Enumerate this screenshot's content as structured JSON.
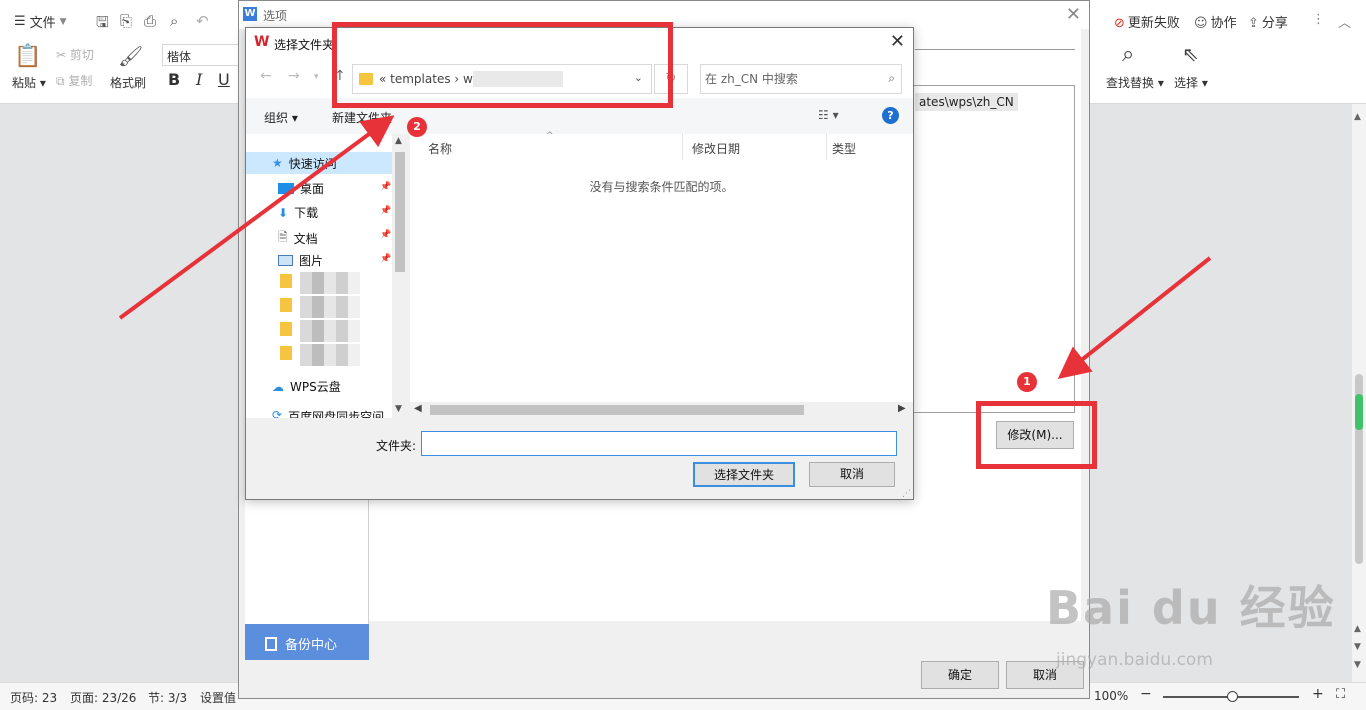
{
  "ribbon": {
    "file_menu": "文件",
    "paste": "粘贴",
    "cut": "剪切",
    "copy": "复制",
    "format_painter": "格式刷",
    "font_name": "楷体",
    "bold": "B",
    "italic": "I",
    "underline": "U",
    "update_failed": "更新失败",
    "collaborate": "协作",
    "share": "分享",
    "find_replace": "查找替换",
    "select": "选择"
  },
  "status_bar": {
    "page_code": "页码: 23",
    "pages": "页面: 23/26",
    "section": "节: 3/3",
    "setting_value": "设置值",
    "zoom": "100%"
  },
  "options_dialog": {
    "title": "选项",
    "path_fragment": "ates\\wps\\zh_CN",
    "modify_button": "修改(M)...",
    "backup_center": "备份中心",
    "ok_button": "确定",
    "cancel_button": "取消"
  },
  "picker": {
    "title": "选择文件夹",
    "breadcrumb": "« templates › wp",
    "search_placeholder": "在 zh_CN 中搜索",
    "organize": "组织 ▾",
    "new_folder": "新建文件夹",
    "nav_items": {
      "quick_access": "快速访问",
      "desktop": "桌面",
      "downloads": "下载",
      "documents": "文档",
      "pictures": "图片",
      "wps_cloud": "WPS云盘",
      "baidu_sync": "百度网盘同步空间"
    },
    "columns": [
      "名称",
      "修改日期",
      "类型"
    ],
    "empty_message": "没有与搜索条件匹配的项。",
    "folder_label": "文件夹:",
    "folder_value": "",
    "select_button": "选择文件夹",
    "cancel_button": "取消"
  },
  "annotations": {
    "badge_1": "1",
    "badge_2": "2",
    "color": "#e8323a"
  },
  "watermark": {
    "brand": "Bai du 经验",
    "url": "jingyan.baidu.com"
  },
  "icons": [
    "menu-icon",
    "save-icon",
    "print-icon",
    "undo-icon",
    "paste-icon",
    "scissors-icon",
    "copy-icon",
    "brush-icon",
    "search-icon",
    "cursor-icon",
    "folder-icon",
    "star-icon",
    "desktop-icon",
    "download-icon",
    "document-icon",
    "picture-icon",
    "cloud-icon",
    "pin-icon",
    "help-icon",
    "refresh-icon",
    "close-icon"
  ]
}
